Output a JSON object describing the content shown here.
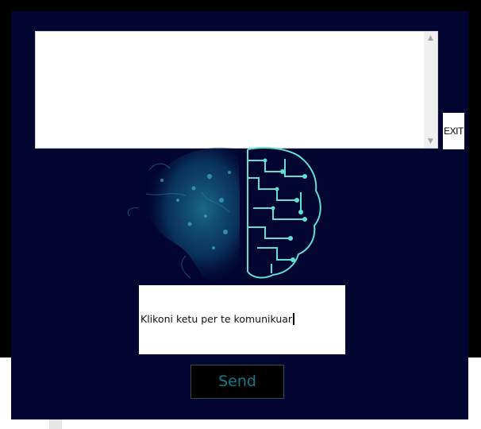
{
  "window": {
    "exit_label": "EXIT"
  },
  "chat": {
    "log_text": "",
    "scroll_up_glyph": "▲",
    "scroll_down_glyph": "▼"
  },
  "composer": {
    "input_text": "Klikoni ketu per te komunikuar",
    "send_label": "Send"
  },
  "icons": {
    "illustration": "brain-circuit-illustration",
    "scroll_up": "chevron-up-icon",
    "scroll_down": "chevron-down-icon"
  },
  "colors": {
    "panel_background": "#01052f",
    "circuit_accent": "#5fe0d0",
    "send_text": "#0f7d86"
  }
}
